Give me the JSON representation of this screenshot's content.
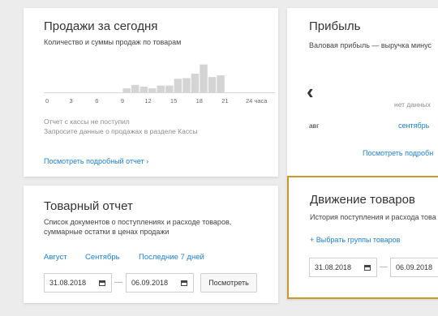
{
  "sales_card": {
    "title": "Продажи за сегодня",
    "subtitle": "Количество и суммы продаж по товарам",
    "no_data_line1": "Отчет с кассы не поступил",
    "no_data_line2": "Запросите данные о продажах в разделе Кассы",
    "details_link": "Посмотреть подробный отчет ›"
  },
  "profit_card": {
    "title": "Прибыль",
    "subtitle": "Валовая прибыль — выручка минус",
    "prev_arrow": "‹",
    "no_data": "нет данных",
    "month_prev": "авг",
    "month_current": "сентябрь",
    "details_link": "Посмотреть подробн"
  },
  "goods_report_card": {
    "title": "Товарный отчет",
    "subtitle_line1": "Список документов о поступлениях и расходе товаров,",
    "subtitle_line2": "суммарные остатки в ценах продажи",
    "period_links": [
      "Август",
      "Сентябрь",
      "Последние 7 дней"
    ],
    "date_from": "31.08.2018",
    "date_to": "06.09.2018",
    "dash": "—",
    "view_button": "Посмотреть"
  },
  "movement_card": {
    "title": "Движение товаров",
    "subtitle": "История поступления и расхода това",
    "select_groups_link": "+ Выбрать группы товаров",
    "date_from": "31.08.2018",
    "date_to": "06.09.2018",
    "dash": "—",
    "highlight_color": "#c99a2e"
  },
  "chart_data": {
    "type": "bar",
    "x_ticks": [
      "0",
      "3",
      "6",
      "9",
      "12",
      "15",
      "18",
      "21",
      "24 часа"
    ],
    "hours": [
      0,
      1,
      2,
      3,
      4,
      5,
      6,
      7,
      8,
      9,
      10,
      11,
      12,
      13,
      14,
      15,
      16,
      17,
      18,
      19,
      20,
      21,
      22,
      23
    ],
    "values": [
      0,
      0,
      0,
      0,
      0,
      0,
      0,
      0,
      0,
      0.12,
      0.22,
      0.17,
      0.12,
      0.2,
      0.2,
      0.4,
      0.42,
      0.55,
      0.82,
      0.45,
      0.5,
      0,
      0,
      0
    ],
    "ylim": [
      0,
      1
    ],
    "bar_color": "#d4d4d4",
    "grid": false,
    "title": "",
    "xlabel": "",
    "ylabel": ""
  }
}
